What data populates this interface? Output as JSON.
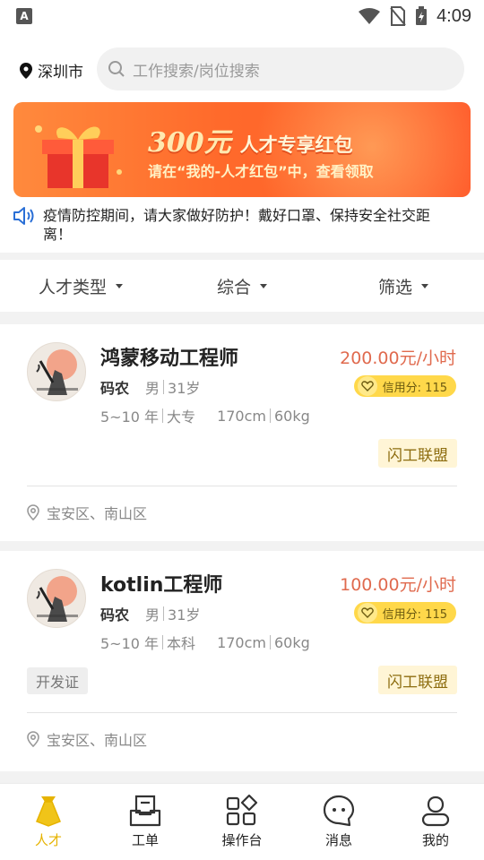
{
  "status_bar": {
    "app_letter": "A",
    "time": "4:09"
  },
  "header": {
    "city": "深圳市",
    "search_placeholder": "工作搜索/岗位搜索"
  },
  "banner": {
    "amount": "300元",
    "subtitle": "人才专享红包",
    "line": "请在“我的-人才红包”中，查看领取"
  },
  "notice": {
    "text": "疫情防控期间，请大家做好防护！戴好口罩、保持安全社交距离！"
  },
  "filters": [
    {
      "label": "人才类型"
    },
    {
      "label": "综合"
    },
    {
      "label": "筛选"
    }
  ],
  "cards": [
    {
      "title": "鸿蒙移动工程师",
      "nickname": "码农",
      "gender": "男",
      "age": "31岁",
      "experience": "5~10 年",
      "education": "大专",
      "height": "170cm",
      "weight": "60kg",
      "price": "200.00元/小时",
      "credit": "信用分: 115",
      "alliance_tag": "闪工联盟",
      "address": "宝安区、南山区"
    },
    {
      "title": "kotlin工程师",
      "nickname": "码农",
      "gender": "男",
      "age": "31岁",
      "experience": "5~10 年",
      "education": "本科",
      "height": "170cm",
      "weight": "60kg",
      "price": "100.00元/小时",
      "credit": "信用分: 115",
      "alliance_tag": "闪工联盟",
      "cert_tag": "开发证",
      "address": "宝安区、南山区"
    }
  ],
  "tabbar": [
    {
      "label": "人才",
      "icon": "talent-icon",
      "active": true
    },
    {
      "label": "工单",
      "icon": "workorder-icon",
      "active": false
    },
    {
      "label": "操作台",
      "icon": "console-icon",
      "active": false
    },
    {
      "label": "消息",
      "icon": "message-icon",
      "active": false
    },
    {
      "label": "我的",
      "icon": "profile-icon",
      "active": false
    }
  ],
  "colors": {
    "accent": "#e6b300",
    "price": "#e06a4e",
    "credit_bg": "#ffd84a",
    "banner": "#ff6a2b"
  }
}
